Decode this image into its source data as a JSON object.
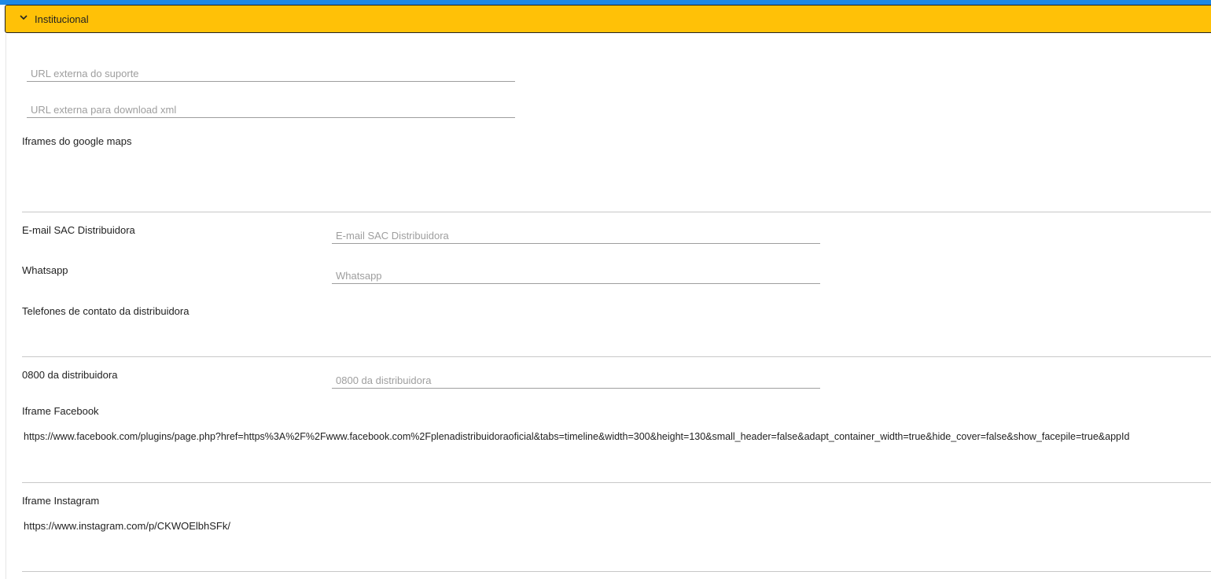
{
  "panel": {
    "title": "Institucional"
  },
  "fields": {
    "url_suporte": {
      "placeholder": "URL externa do suporte",
      "value": ""
    },
    "url_xml": {
      "placeholder": "URL externa para download xml",
      "value": ""
    },
    "iframes_maps": {
      "label": "Iframes do google maps",
      "value": ""
    },
    "email_sac": {
      "label": "E-mail SAC Distribuidora",
      "placeholder": "E-mail SAC Distribuidora",
      "value": ""
    },
    "whatsapp": {
      "label": "Whatsapp",
      "placeholder": "Whatsapp",
      "value": ""
    },
    "telefones": {
      "label": "Telefones de contato da distribuidora",
      "value": ""
    },
    "tel_0800": {
      "label": "0800 da distribuidora",
      "placeholder": "0800 da distribuidora",
      "value": ""
    },
    "iframe_facebook": {
      "label": "Iframe Facebook",
      "value": "https://www.facebook.com/plugins/page.php?href=https%3A%2F%2Fwww.facebook.com%2Fplenadistribuidoraoficial&tabs=timeline&width=300&height=130&small_header=false&adapt_container_width=true&hide_cover=false&show_facepile=true&appId"
    },
    "iframe_instagram": {
      "label": "Iframe Instagram",
      "value": "https://www.instagram.com/p/CKWOElbhSFk/"
    }
  },
  "colors": {
    "header_bg": "#ffc107",
    "top_strip": "#1e88e5"
  }
}
